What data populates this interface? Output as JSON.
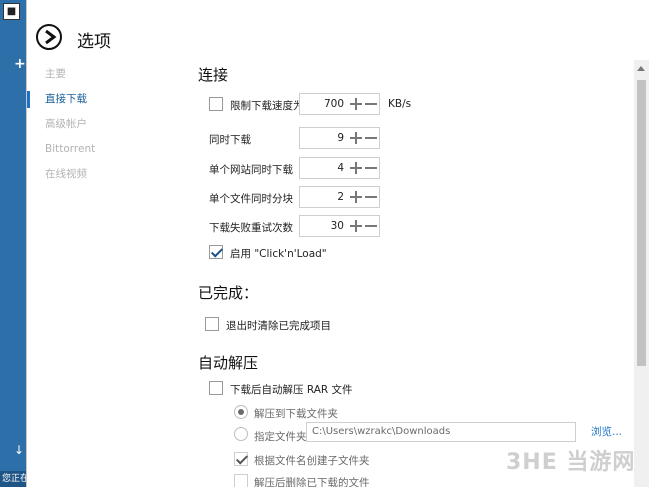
{
  "background_app": {
    "status_text": "您正在"
  },
  "dialog": {
    "title": "选项"
  },
  "nav": {
    "items": [
      {
        "label": "主要",
        "active": false
      },
      {
        "label": "直接下载",
        "active": true
      },
      {
        "label": "高级帐户",
        "active": false
      },
      {
        "label": "Bittorrent",
        "active": false
      },
      {
        "label": "在线视频",
        "active": false
      }
    ]
  },
  "connection": {
    "title": "连接",
    "limit_speed_label": "限制下载速度为",
    "limit_speed_checked": false,
    "limit_speed_value": "700",
    "limit_speed_unit": "KB/s",
    "simultaneous_label": "同时下载",
    "simultaneous_value": "9",
    "per_site_label": "单个网站同时下载",
    "per_site_value": "4",
    "per_file_label": "单个文件同时分块",
    "per_file_value": "2",
    "retries_label": "下载失败重试次数",
    "retries_value": "30",
    "clicknload_label": "启用 \"Click'n'Load\"",
    "clicknload_checked": true
  },
  "completed": {
    "title": "已完成：",
    "clear_on_exit_label": "退出时清除已完成项目",
    "clear_on_exit_checked": false
  },
  "auto_extract": {
    "title": "自动解压",
    "extract_rar_label": "下载后自动解压 RAR 文件",
    "extract_rar_checked": false,
    "extract_to_download_label": "解压到下载文件夹",
    "extract_to_download_selected": true,
    "custom_folder_label": "指定文件夹",
    "custom_folder_selected": false,
    "custom_folder_path": "C:\\Users\\wzrakc\\Downloads",
    "browse_label": "浏览...",
    "subfolder_label": "根据文件名创建子文件夹",
    "subfolder_checked": true,
    "delete_after_label": "解压后删除已下载的文件",
    "delete_after_checked": false
  },
  "watermark": {
    "text": "3HE 当游网"
  }
}
